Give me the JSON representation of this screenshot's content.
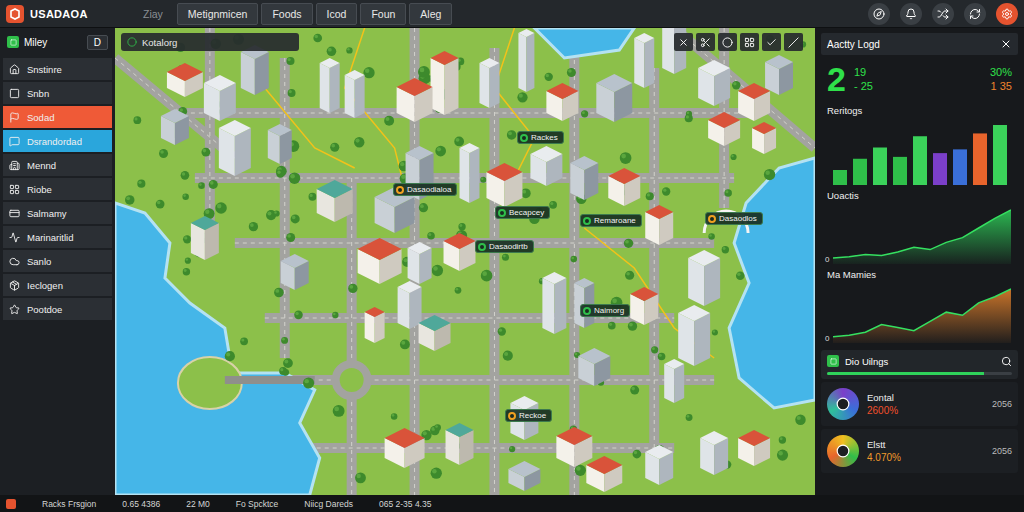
{
  "app": {
    "title": "USADAOA"
  },
  "tabs": [
    {
      "label": "Ziay",
      "selected": false,
      "disabled": true
    },
    {
      "label": "Metignmicen",
      "selected": false,
      "disabled": false
    },
    {
      "label": "Foods",
      "selected": false,
      "disabled": false
    },
    {
      "label": "Icod",
      "selected": false,
      "disabled": false
    },
    {
      "label": "Foun",
      "selected": false,
      "disabled": false
    },
    {
      "label": "Aleg",
      "selected": false,
      "disabled": false
    }
  ],
  "sidebar": {
    "header": {
      "label": "Miley",
      "badge": "D"
    },
    "items": [
      {
        "label": "Snstinre",
        "selected": false
      },
      {
        "label": "Snbn",
        "selected": false
      },
      {
        "label": "Sodad",
        "selected": true,
        "color": "#ef5a37"
      },
      {
        "label": "Dsrandordad",
        "selected": true,
        "color": "#2aa6dc"
      },
      {
        "label": "Mennd",
        "selected": false
      },
      {
        "label": "Riobe",
        "selected": false
      },
      {
        "label": "Salmamy",
        "selected": false
      },
      {
        "label": "Marinaritlid",
        "selected": false
      },
      {
        "label": "Sanlo",
        "selected": false
      },
      {
        "label": "Ieclogen",
        "selected": false
      },
      {
        "label": "Pootdoe",
        "selected": false
      }
    ]
  },
  "map": {
    "search": "Kotalorg",
    "labels": [
      {
        "text": "Rackes",
        "color": "#2fbf4a"
      },
      {
        "text": "Dasaodialoa",
        "color": "#f0a020"
      },
      {
        "text": "Becapcey",
        "color": "#2fbf4a"
      },
      {
        "text": "Dasaodirtb",
        "color": "#2fbf4a"
      },
      {
        "text": "Remaroane",
        "color": "#2fbf4a"
      },
      {
        "text": "Dasaodlos",
        "color": "#f0a020"
      },
      {
        "text": "Naimorg",
        "color": "#2fbf4a"
      },
      {
        "text": "Reckoe",
        "color": "#f0a020"
      }
    ]
  },
  "activity": {
    "title": "Aactty Logd",
    "total": "2",
    "deltas": [
      "19",
      "- 25"
    ],
    "rates": [
      "30%",
      "1 35"
    ]
  },
  "bar_chart": {
    "title": "Reritogs",
    "values": [
      16,
      28,
      40,
      30,
      52,
      34,
      38,
      55,
      64
    ],
    "colors": [
      "#2fbf4a",
      "#2fbf4a",
      "#3bd25a",
      "#2fbf4a",
      "#3bd25a",
      "#7b3fc9",
      "#3a6fd8",
      "#e8642c",
      "#3bd25a"
    ]
  },
  "area_charts": [
    {
      "title": "Uoactis",
      "axis": "0",
      "values": [
        5,
        6,
        8,
        7,
        10,
        14,
        12,
        18,
        22,
        30,
        38,
        45
      ],
      "color": "#2fd25a"
    },
    {
      "title": "Ma Mamies",
      "axis": "0",
      "values": [
        4,
        5,
        7,
        12,
        10,
        8,
        14,
        20,
        18,
        26,
        30,
        35
      ],
      "color": "#e8842c"
    }
  ],
  "usage": {
    "title": "Dio Uilngs",
    "level": 0.85,
    "items": [
      {
        "name": "Eontal",
        "value": "2600%",
        "count": "2056",
        "color": "#f0502c"
      },
      {
        "name": "Elstt",
        "value": "4.070%",
        "count": "2056",
        "color": "#f09a2c"
      }
    ]
  },
  "status_bar": [
    "Racks Frsgion",
    "0.65 4386",
    "22 M0",
    "Fo Spcktce",
    "Niicg Dareds",
    "065 2-35 4.35"
  ]
}
